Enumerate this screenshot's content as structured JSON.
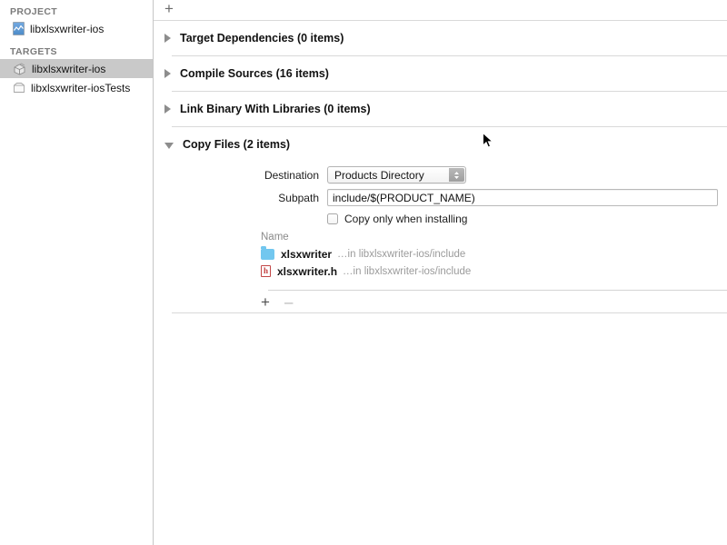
{
  "sidebar": {
    "project_header": "PROJECT",
    "targets_header": "TARGETS",
    "project_items": [
      {
        "label": "libxlsxwriter-ios",
        "icon": "xcode-project-icon"
      }
    ],
    "target_items": [
      {
        "label": "libxlsxwriter-ios",
        "icon": "target-package-icon",
        "selected": true
      },
      {
        "label": "libxlsxwriter-iosTests",
        "icon": "target-tests-icon",
        "selected": false
      }
    ],
    "selection_color": "#c9c9c9"
  },
  "toolbar": {
    "add_label": "+"
  },
  "build_phases": [
    {
      "title": "Target Dependencies (0 items)",
      "expanded": false
    },
    {
      "title": "Compile Sources (16 items)",
      "expanded": false
    },
    {
      "title": "Link Binary With Libraries (0 items)",
      "expanded": false
    },
    {
      "title": "Copy Files (2 items)",
      "expanded": true
    }
  ],
  "copy_files": {
    "destination_label": "Destination",
    "destination_value": "Products Directory",
    "destination_options": [
      "Products Directory"
    ],
    "subpath_label": "Subpath",
    "subpath_value": "include/$(PRODUCT_NAME)",
    "subpath_placeholder": "",
    "copy_only_label": "Copy only when installing",
    "copy_only_checked": false,
    "name_column_header": "Name",
    "files": [
      {
        "name": "xlsxwriter",
        "path": "…in libxlsxwriter-ios/include",
        "icon": "folder-icon"
      },
      {
        "name": "xlsxwriter.h",
        "path": "…in libxlsxwriter-ios/include",
        "icon": "header-file-icon",
        "badge": "h"
      }
    ],
    "add_label": "+",
    "remove_label": "–"
  },
  "colors": {
    "folder_blue": "#72c7ef",
    "header_red": "#c23a3a",
    "divider": "#d9d9d9",
    "secondary_text": "#9b9b9b"
  }
}
